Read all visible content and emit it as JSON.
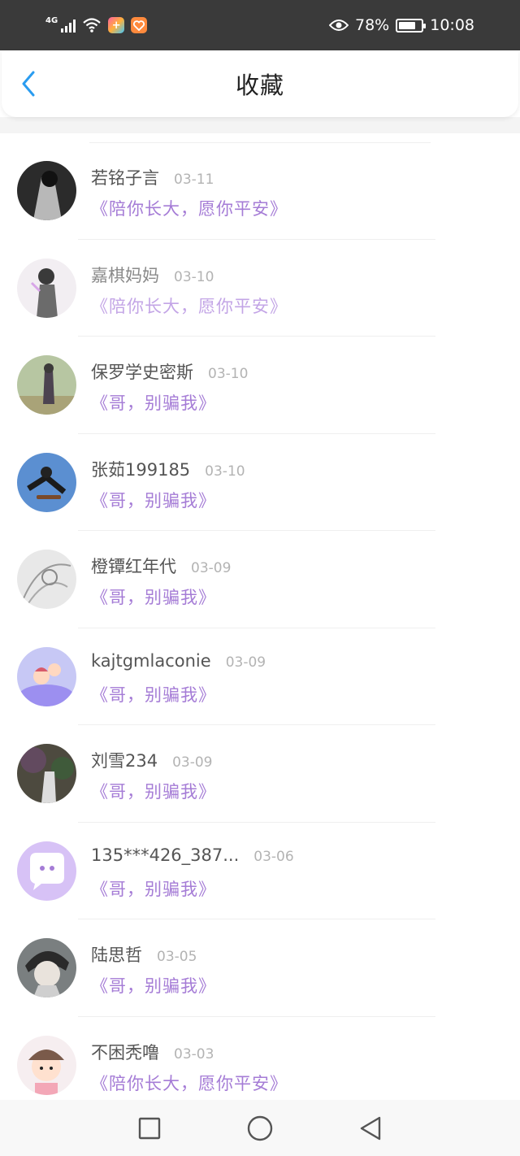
{
  "status_bar": {
    "network": "4G",
    "battery_percent": "78%",
    "battery_level": 0.78,
    "time": "10:08",
    "icons": [
      "signal-icon",
      "wifi-icon",
      "app-notification-icon",
      "app-notification-icon-2",
      "eye-icon",
      "battery-icon"
    ]
  },
  "header": {
    "title": "收藏",
    "back_icon": "chevron-left-icon",
    "accent": "#2a9cf0"
  },
  "favorites": [
    {
      "name": "若铭子言",
      "date": "03-11",
      "title": "《陪你长大，愿你平安》",
      "avatar_bg": "#2b2b2b"
    },
    {
      "name": "嘉棋妈妈",
      "date": "03-10",
      "title": "《陪你长大，愿你平安》",
      "avatar_bg": "#f2eef2"
    },
    {
      "name": "保罗学史密斯",
      "date": "03-10",
      "title": "《哥，别骗我》",
      "avatar_bg": "#b7c6a2"
    },
    {
      "name": "张茹199185",
      "date": "03-10",
      "title": "《哥，别骗我》",
      "avatar_bg": "#5b8fd1"
    },
    {
      "name": "橙镡红年代",
      "date": "03-09",
      "title": "《哥，别骗我》",
      "avatar_bg": "#e8e8e8"
    },
    {
      "name": "kajtgmlaconie",
      "date": "03-09",
      "title": "《哥，别骗我》",
      "avatar_bg": "#c7c8f5"
    },
    {
      "name": "刘雪234",
      "date": "03-09",
      "title": "《哥，别骗我》",
      "avatar_bg": "#4d4a3f"
    },
    {
      "name": "135***426_387...",
      "date": "03-06",
      "title": "《哥，别骗我》",
      "avatar_bg": "#d7c2f6"
    },
    {
      "name": "陆思哲",
      "date": "03-05",
      "title": "《哥，别骗我》",
      "avatar_bg": "#7a7f80"
    },
    {
      "name": "不困秃噜",
      "date": "03-03",
      "title": "《陪你长大，愿你平安》",
      "avatar_bg": "#f6eef0"
    }
  ],
  "nav_bar": {
    "icons": [
      "recent-apps-icon",
      "home-icon",
      "back-icon"
    ]
  }
}
